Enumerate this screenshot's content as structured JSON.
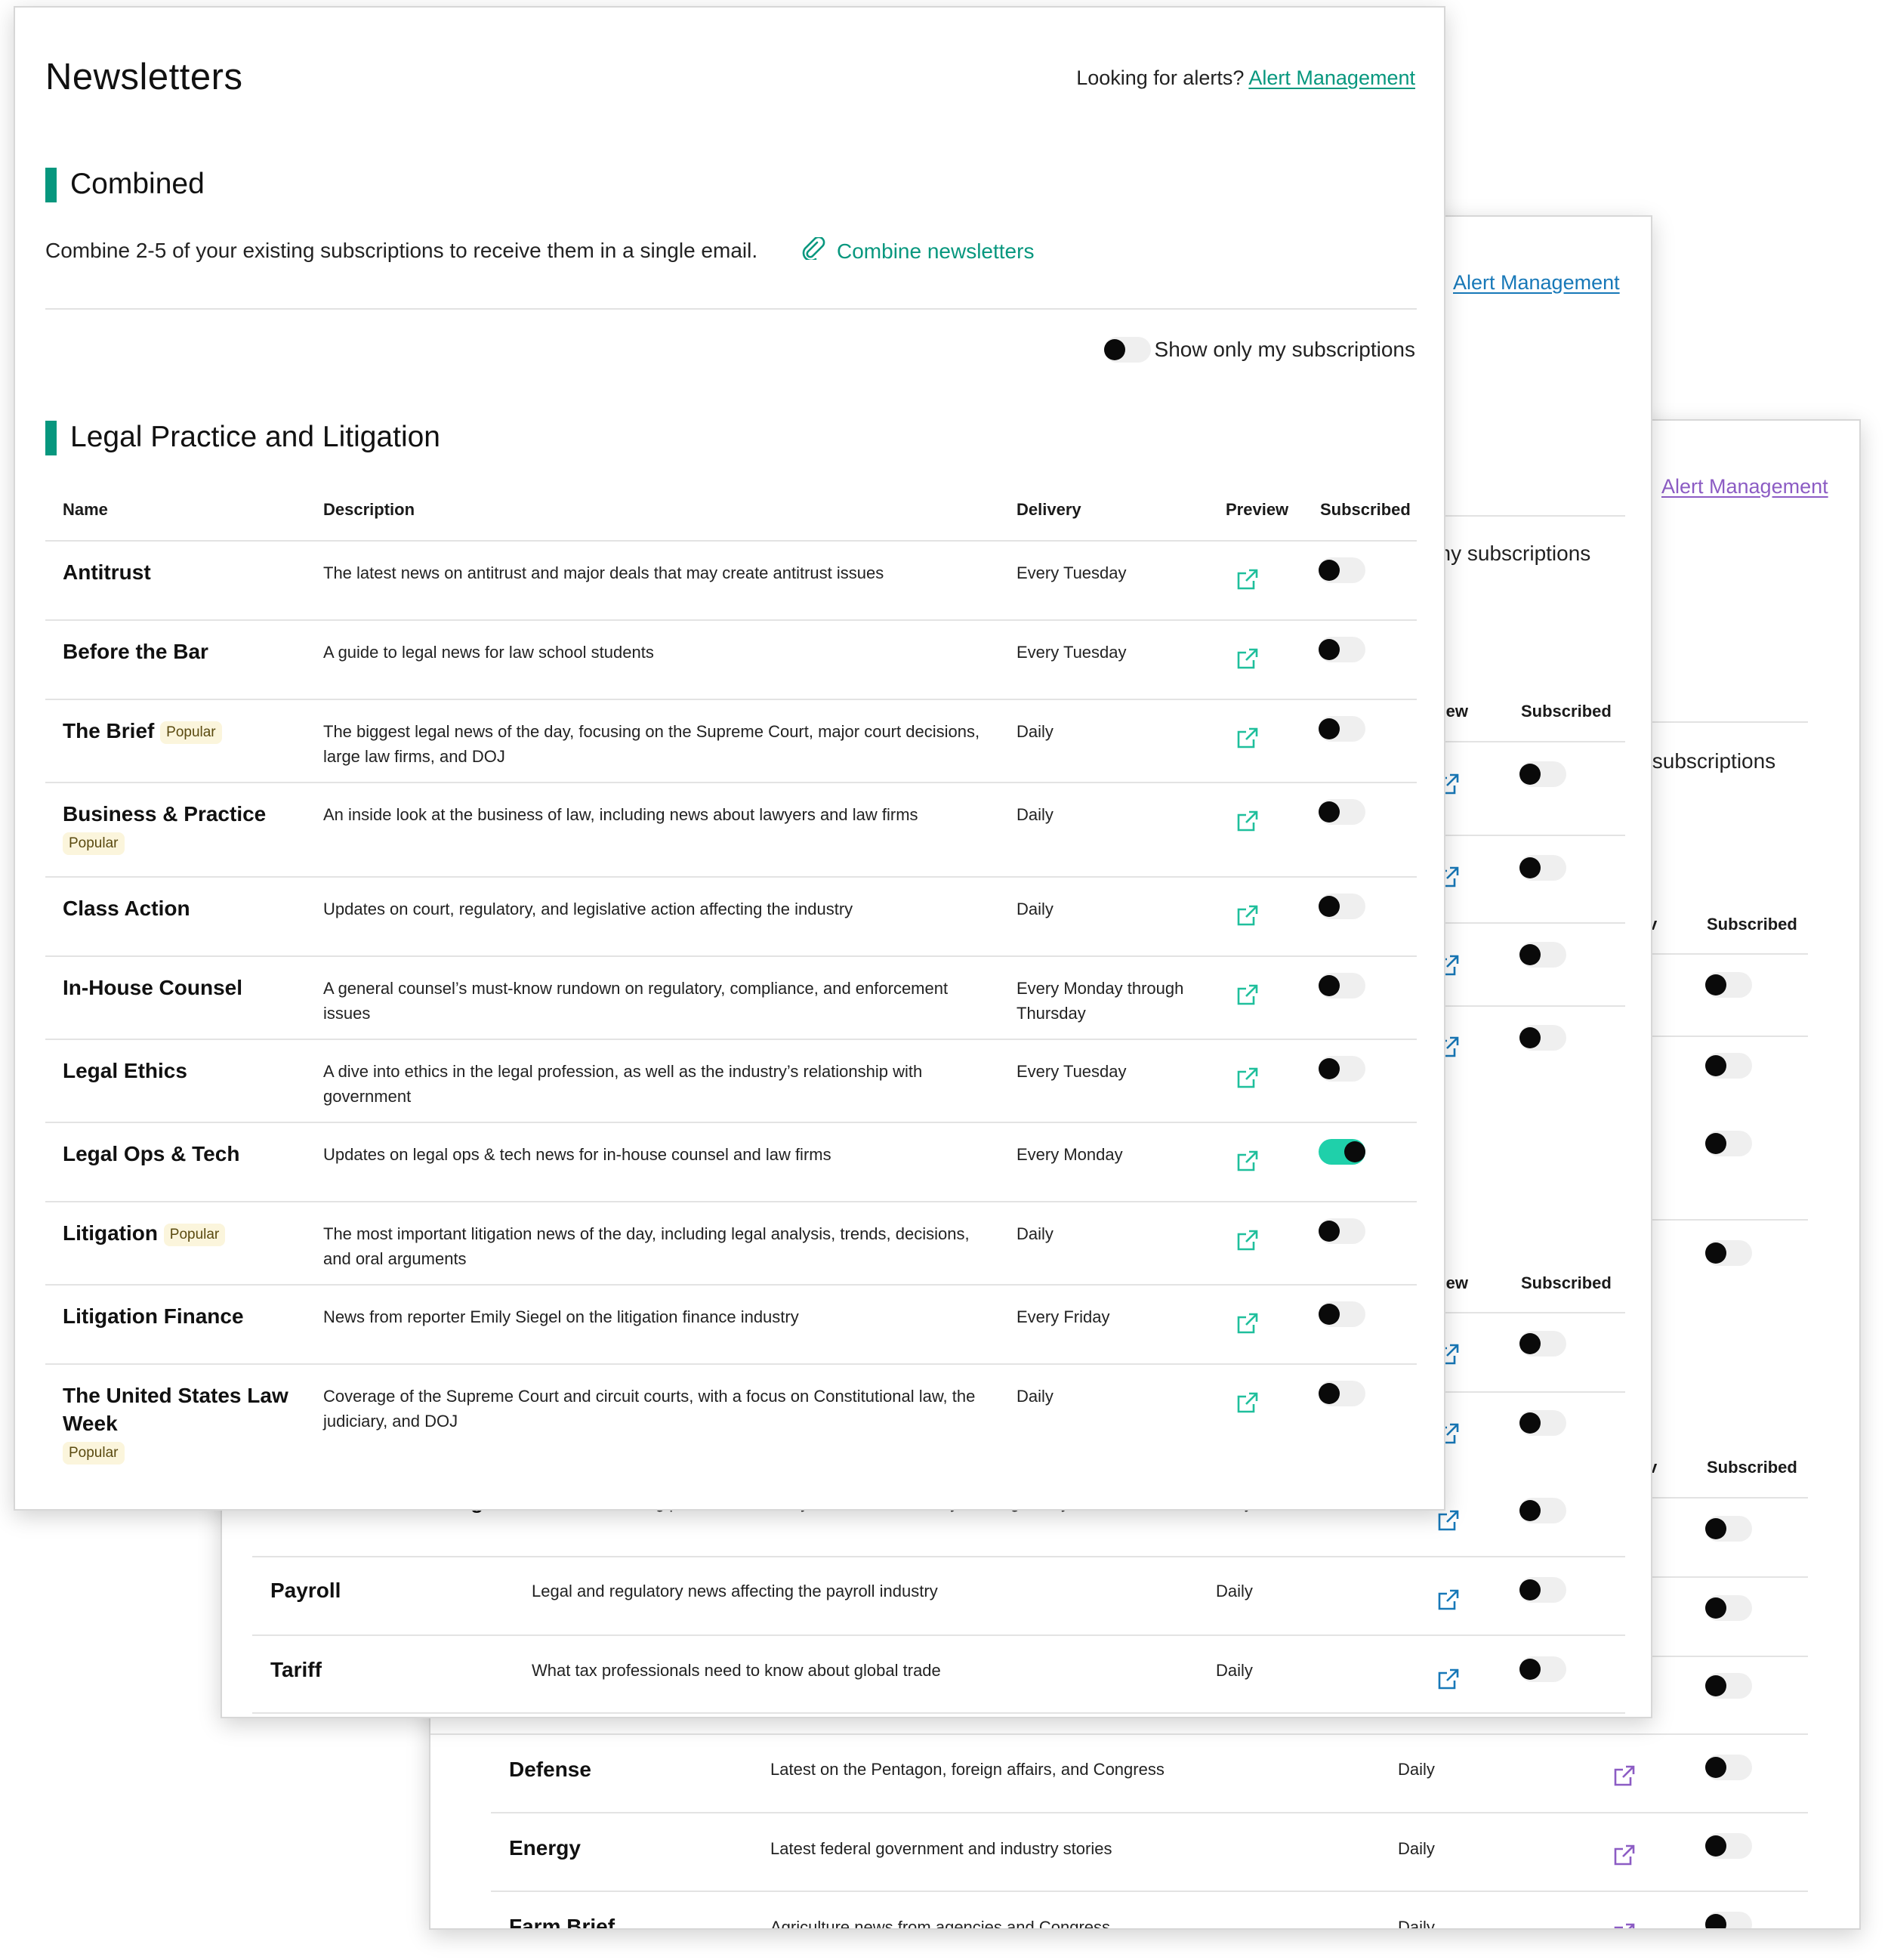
{
  "colors": {
    "front_accent": "#07977e",
    "front_link": "#07977e",
    "middle_link": "#1778b8",
    "back_link": "#8c5cc4",
    "toggle_on": "#1fd0aa",
    "knob": "#0a0a0a",
    "track": "#efefef"
  },
  "front": {
    "title": "Newsletters",
    "alert_prefix": "Looking for alerts?",
    "alert_link": "Alert Management",
    "combined": {
      "heading": "Combined",
      "text": "Combine 2-5 of your existing subscriptions to receive them in a single email.",
      "link": "Combine newsletters",
      "link_icon": "paperclip-icon"
    },
    "show_only": {
      "label": "Show only my subscriptions",
      "on": false
    },
    "section": {
      "heading": "Legal Practice and Litigation",
      "columns": {
        "name": "Name",
        "description": "Description",
        "delivery": "Delivery",
        "preview": "Preview",
        "subscribed": "Subscribed"
      },
      "rows": [
        {
          "name": "Antitrust",
          "badge": "",
          "description": "The latest news on antitrust and major deals that may create antitrust issues",
          "delivery": "Every Tuesday",
          "subscribed": false
        },
        {
          "name": "Before the Bar",
          "badge": "",
          "description": "A guide to legal news for law school students",
          "delivery": "Every Tuesday",
          "subscribed": false
        },
        {
          "name": "The Brief",
          "badge": "Popular",
          "description": "The biggest legal news of the day, focusing on the Supreme Court, major court decisions, large law firms, and DOJ",
          "delivery": "Daily",
          "subscribed": false
        },
        {
          "name": "Business & Practice",
          "badge": "Popular",
          "description": "An inside look at the business of law, including news about lawyers and law firms",
          "delivery": "Daily",
          "subscribed": false
        },
        {
          "name": "Class Action",
          "badge": "",
          "description": "Updates on court, regulatory, and legislative action affecting the industry",
          "delivery": "Daily",
          "subscribed": false
        },
        {
          "name": "In-House Counsel",
          "badge": "",
          "description": "A general counsel’s must-know rundown on regulatory, compliance, and enforcement issues",
          "delivery": "Every Monday through Thursday",
          "subscribed": false
        },
        {
          "name": "Legal Ethics",
          "badge": "",
          "description": "A dive into ethics in the legal profession, as well as the industry’s relationship with government",
          "delivery": "Every Tuesday",
          "subscribed": false
        },
        {
          "name": "Legal Ops & Tech",
          "badge": "",
          "description": "Updates on legal ops & tech news for in-house counsel and law firms",
          "delivery": "Every Monday",
          "subscribed": true
        },
        {
          "name": "Litigation",
          "badge": "Popular",
          "description": "The most important litigation news of the day, including legal analysis, trends, decisions, and oral arguments",
          "delivery": "Daily",
          "subscribed": false
        },
        {
          "name": "Litigation Finance",
          "badge": "",
          "description": "News from reporter Emily Siegel on the litigation finance industry",
          "delivery": "Every Friday",
          "subscribed": false
        },
        {
          "name": "The United States Law Week",
          "badge": "Popular",
          "description": "Coverage of the Supreme Court and circuit courts, with a focus on Constitutional law, the judiciary, and DOJ",
          "delivery": "Daily",
          "subscribed": false
        }
      ]
    }
  },
  "middle": {
    "alert_link": "Alert Management",
    "show_only_fragment": "y my subscriptions",
    "header_preview_fragment": "eview",
    "header_subscribed": "Subscribed",
    "partial_row_name": "Financial Accounting",
    "partial_row_desc": "Global accounting professionals’ daily rundown of industry and regulatory news",
    "partial_row_delivery": "Daily",
    "rows": [
      {
        "name": "Payroll",
        "description": "Legal and regulatory news affecting the payroll industry",
        "delivery": "Daily",
        "subscribed": false
      },
      {
        "name": "Tariff",
        "description": "What tax professionals need to know about global trade",
        "delivery": "Daily",
        "subscribed": false
      }
    ]
  },
  "back": {
    "alert_link": "Alert Management",
    "show_only_fragment": "y subscriptions",
    "header_preview_fragment": "v",
    "header_subscribed": "Subscribed",
    "rows": [
      {
        "name": "Defense",
        "description": "Latest on the Pentagon, foreign affairs, and Congress",
        "delivery": "Daily",
        "subscribed": false
      },
      {
        "name": "Energy",
        "description": "Latest federal government and industry stories",
        "delivery": "Daily",
        "subscribed": false
      },
      {
        "name": "Farm Brief",
        "description": "Agriculture news from agencies and Congress",
        "delivery": "Daily",
        "subscribed": false
      }
    ]
  }
}
